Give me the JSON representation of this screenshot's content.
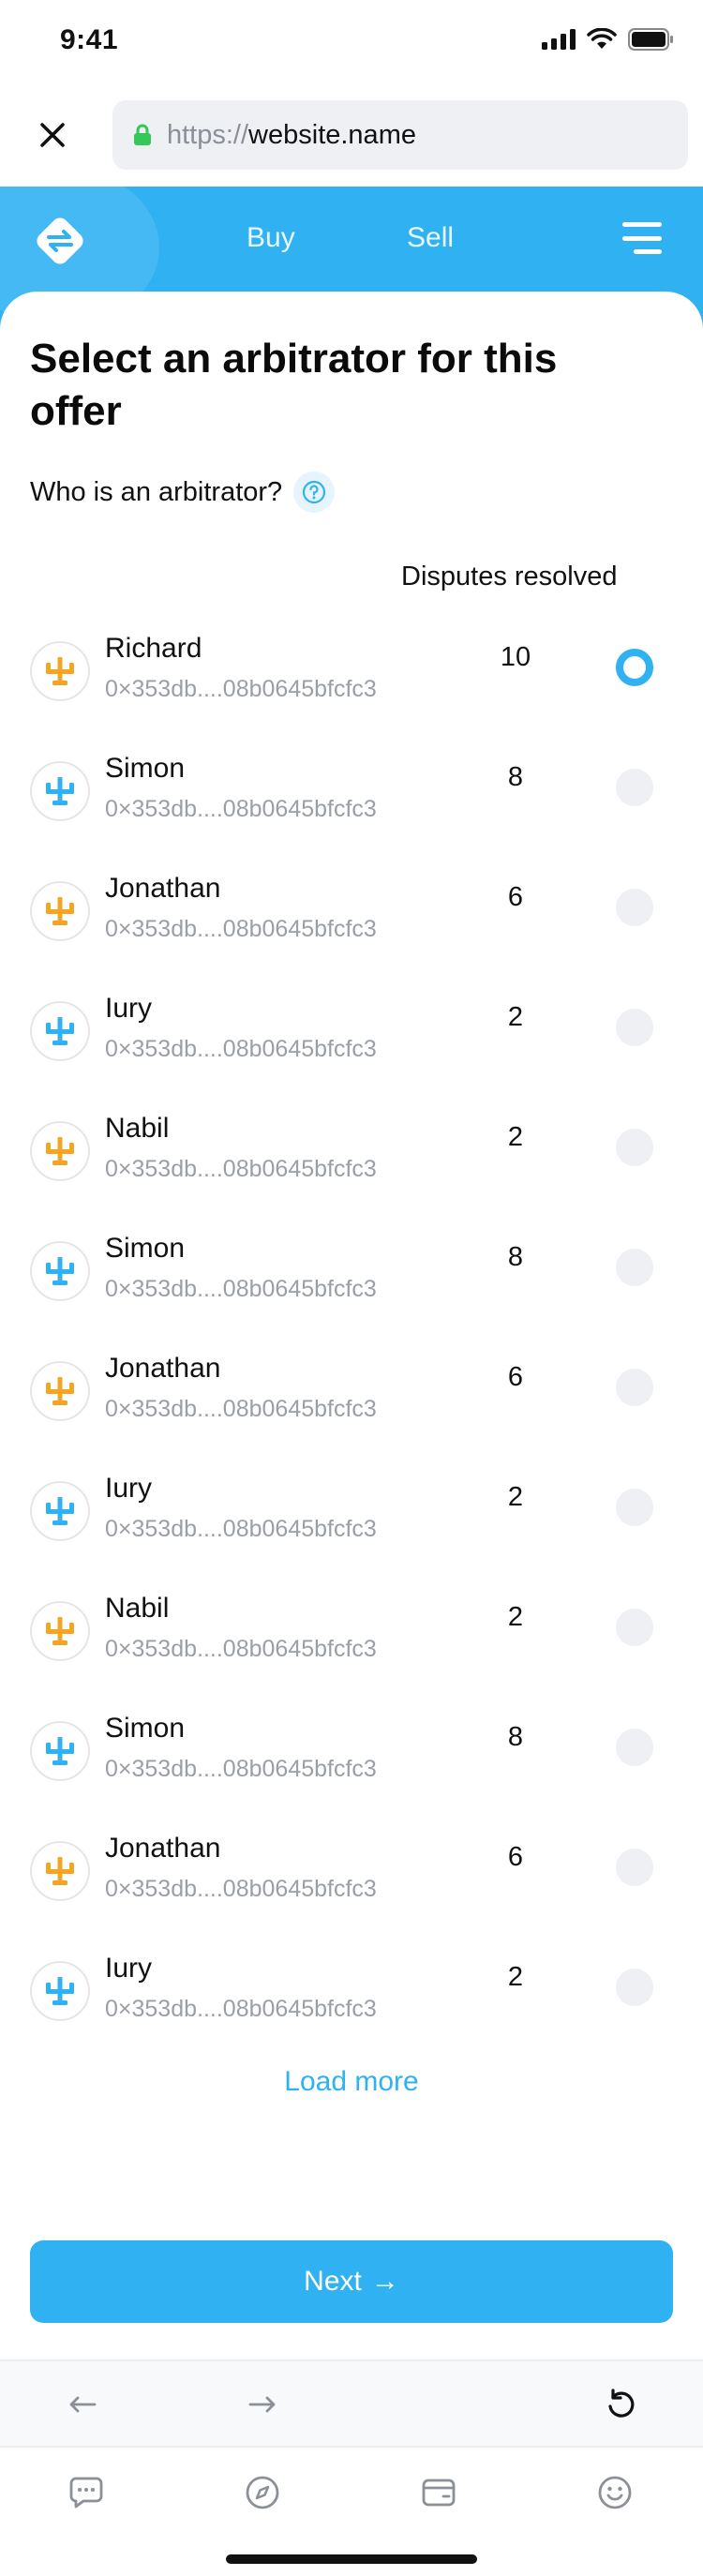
{
  "status_bar": {
    "time": "9:41",
    "icons": [
      "signal-icon",
      "wifi-icon",
      "battery-icon"
    ]
  },
  "url_bar": {
    "protocol": "https://",
    "host": "website.name",
    "lock_icon": "lock-icon",
    "close_icon": "close-icon"
  },
  "header": {
    "logo_icon": "swap-logo-icon",
    "nav": {
      "buy": "Buy",
      "sell": "Sell"
    },
    "menu_icon": "hamburger-menu-icon",
    "brand_color": "#2fb1f2"
  },
  "page": {
    "title": "Select an arbitrator for this offer",
    "info_text": "Who is an arbitrator?",
    "help_icon": "question-circle-icon",
    "column_header": "Disputes resolved"
  },
  "arbitrators": [
    {
      "name": "Richard",
      "address": "0×353db....08b0645bfcfc3",
      "disputes": "10",
      "avatar_color": "#f5a524",
      "selected": true
    },
    {
      "name": "Simon",
      "address": "0×353db....08b0645bfcfc3",
      "disputes": "8",
      "avatar_color": "#2fb1f2",
      "selected": false
    },
    {
      "name": "Jonathan",
      "address": "0×353db....08b0645bfcfc3",
      "disputes": "6",
      "avatar_color": "#f5a524",
      "selected": false
    },
    {
      "name": "Iury",
      "address": "0×353db....08b0645bfcfc3",
      "disputes": "2",
      "avatar_color": "#2fb1f2",
      "selected": false
    },
    {
      "name": "Nabil",
      "address": "0×353db....08b0645bfcfc3",
      "disputes": "2",
      "avatar_color": "#f5a524",
      "selected": false
    },
    {
      "name": "Simon",
      "address": "0×353db....08b0645bfcfc3",
      "disputes": "8",
      "avatar_color": "#2fb1f2",
      "selected": false
    },
    {
      "name": "Jonathan",
      "address": "0×353db....08b0645bfcfc3",
      "disputes": "6",
      "avatar_color": "#f5a524",
      "selected": false
    },
    {
      "name": "Iury",
      "address": "0×353db....08b0645bfcfc3",
      "disputes": "2",
      "avatar_color": "#2fb1f2",
      "selected": false
    },
    {
      "name": "Nabil",
      "address": "0×353db....08b0645bfcfc3",
      "disputes": "2",
      "avatar_color": "#f5a524",
      "selected": false
    },
    {
      "name": "Simon",
      "address": "0×353db....08b0645bfcfc3",
      "disputes": "8",
      "avatar_color": "#2fb1f2",
      "selected": false
    },
    {
      "name": "Jonathan",
      "address": "0×353db....08b0645bfcfc3",
      "disputes": "6",
      "avatar_color": "#f5a524",
      "selected": false
    },
    {
      "name": "Iury",
      "address": "0×353db....08b0645bfcfc3",
      "disputes": "2",
      "avatar_color": "#2fb1f2",
      "selected": false
    }
  ],
  "actions": {
    "load_more": "Load more",
    "next": "Next",
    "next_arrow": "→"
  },
  "browser_toolbar": {
    "icons": [
      "back-arrow-icon",
      "forward-arrow-icon",
      "reload-icon"
    ]
  },
  "tab_bar": {
    "icons": [
      "chat-icon",
      "compass-icon",
      "wallet-icon",
      "smiley-icon"
    ]
  }
}
